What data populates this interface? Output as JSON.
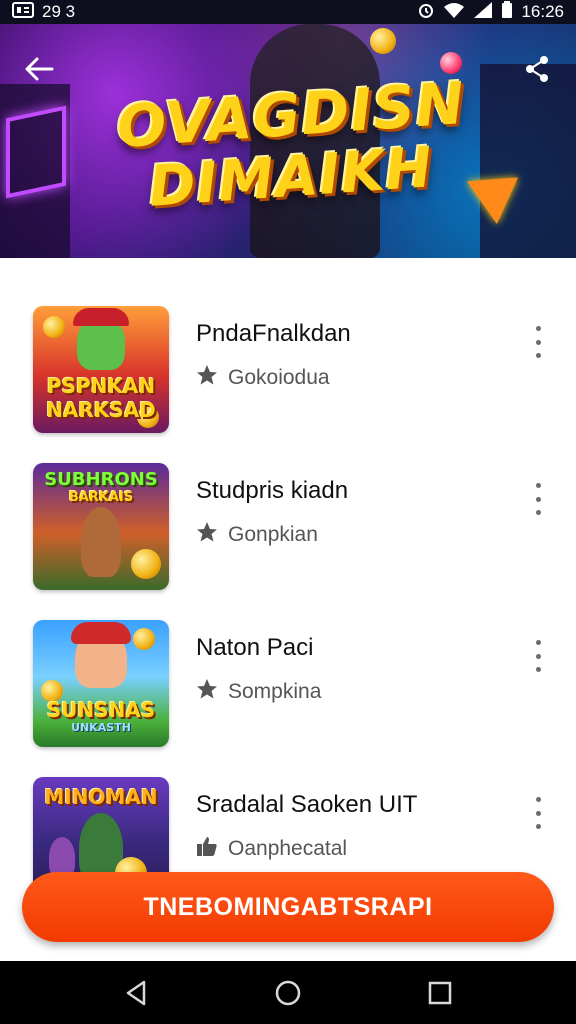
{
  "status_bar": {
    "left_text": "29 3",
    "time": "16:26",
    "icons": [
      "notification-icon",
      "alarm-icon",
      "wifi-icon",
      "signal-icon",
      "battery-icon"
    ]
  },
  "banner": {
    "title_line1": "OVAGDISN",
    "title_line2": "DIMAIKH",
    "back_icon": "back-arrow-icon",
    "share_icon": "share-icon"
  },
  "list": {
    "items": [
      {
        "title": "PndaFnalkdan",
        "subtitle": "Gokoiodua",
        "thumb_label_1": "PSPNKAN",
        "thumb_label_2": "NARKSAD",
        "sub_icon": "star-icon"
      },
      {
        "title": "Studpris kiadn",
        "subtitle": "Gonpkian",
        "thumb_label_1": "SUBHRONS",
        "thumb_label_2": "BARKAIS",
        "sub_icon": "star-icon"
      },
      {
        "title": "Naton Paci",
        "subtitle": "Sompkina",
        "thumb_label_1": "SUNSNAS",
        "thumb_label_2": "UNKASTH",
        "sub_icon": "star-icon"
      },
      {
        "title": "Sradalal Saoken UIT",
        "subtitle": "Oanphecatal",
        "thumb_label_1": "MINOMAN",
        "thumb_label_2": "",
        "sub_icon": "thumbs-up-icon"
      }
    ]
  },
  "cta": {
    "label": "TNEBOMINGABTSRAPI"
  },
  "nav": {
    "back": "nav-back-icon",
    "home": "nav-home-icon",
    "recents": "nav-recents-icon"
  },
  "colors": {
    "accent": "#f33a00",
    "title_gold": "#ffd21a",
    "status_bg": "#0d0f1f"
  }
}
